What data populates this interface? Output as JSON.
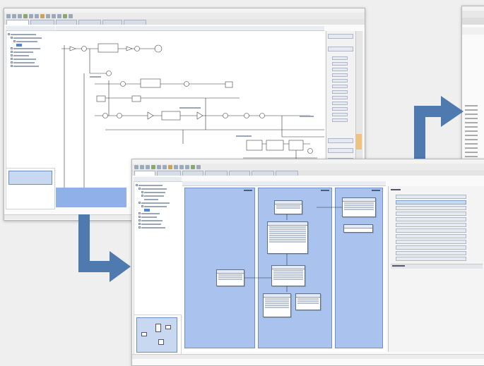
{
  "colors": {
    "accent_arrow": "#4e7aaf",
    "lane_fill": "#a9c2ee",
    "lane_border": "#6f8fc9",
    "workspace_bg": "#efefef",
    "selection_fill": "#8fb0e8"
  },
  "icons": [
    "toolbar-icon",
    "tree-node-icon",
    "palette-tool-icon",
    "flow-arrow-icon"
  ]
}
